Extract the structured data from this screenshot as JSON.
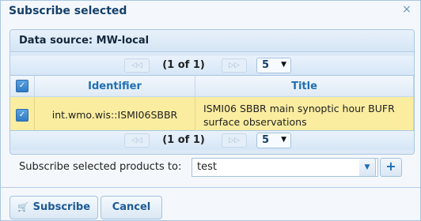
{
  "dialog": {
    "title": "Subscribe selected",
    "close_glyph": "×"
  },
  "panel": {
    "header": "Data source: MW-local"
  },
  "pager": {
    "page_text": "(1 of 1)",
    "page_size": "5",
    "first_glyph": "◁◁",
    "next_glyph": "▷▷",
    "dropdown_glyph": "▼"
  },
  "grid": {
    "columns": [
      "Identifier",
      "Title"
    ],
    "check_glyph": "✓",
    "rows": [
      {
        "selected": true,
        "identifier": "int.wmo.wis::ISMI06SBBR",
        "title": "ISMI06 SBBR main synoptic hour BUFR surface observations"
      }
    ]
  },
  "form": {
    "label": "Subscribe selected products to:",
    "value": "test",
    "add_glyph": "+"
  },
  "buttons": {
    "subscribe": "Subscribe",
    "cancel": "Cancel",
    "subscribe_icon": "cart-icon"
  }
}
